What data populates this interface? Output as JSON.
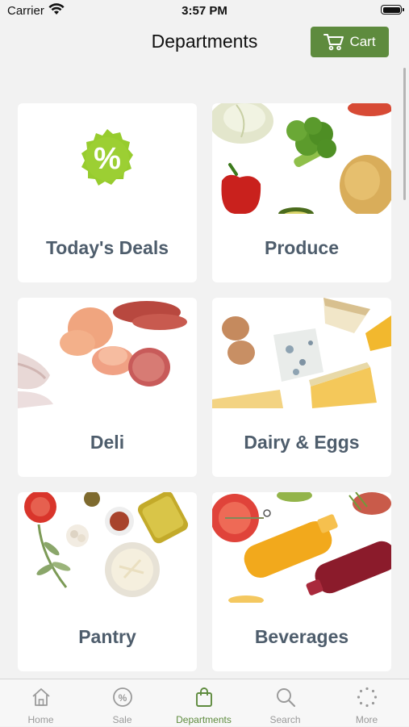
{
  "status": {
    "carrier": "Carrier",
    "time": "3:57 PM"
  },
  "nav": {
    "title": "Departments",
    "cart_label": "Cart"
  },
  "accent_color": "#5e8b3e",
  "departments": [
    {
      "label": "Today's Deals",
      "icon": "percent-badge-icon"
    },
    {
      "label": "Produce",
      "icon": "produce-photo"
    },
    {
      "label": "Deli",
      "icon": "deli-photo"
    },
    {
      "label": "Dairy & Eggs",
      "icon": "dairy-photo"
    },
    {
      "label": "Pantry",
      "icon": "pantry-photo"
    },
    {
      "label": "Beverages",
      "icon": "beverages-photo"
    }
  ],
  "tabs": [
    {
      "label": "Home",
      "icon": "home-icon",
      "active": false
    },
    {
      "label": "Sale",
      "icon": "sale-icon",
      "active": false
    },
    {
      "label": "Departments",
      "icon": "bag-icon",
      "active": true
    },
    {
      "label": "Search",
      "icon": "search-icon",
      "active": false
    },
    {
      "label": "More",
      "icon": "more-icon",
      "active": false
    }
  ]
}
